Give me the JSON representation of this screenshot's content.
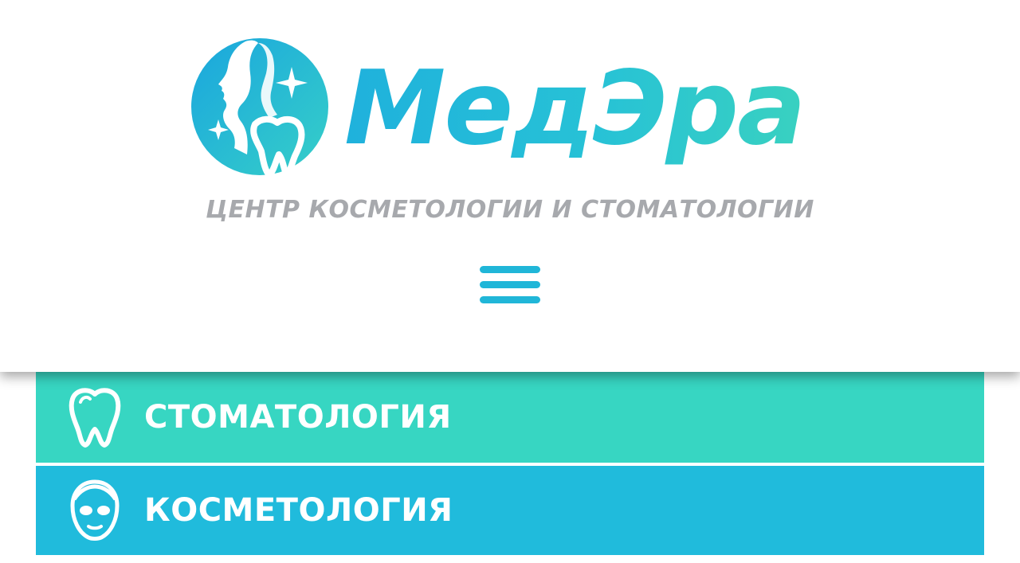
{
  "header": {
    "brand_name": "МедЭра",
    "tagline": "ЦЕНТР КОСМЕТОЛОГИИ И СТОМАТОЛОГИИ",
    "menu_icon": "hamburger-menu-icon"
  },
  "nav": {
    "items": [
      {
        "label": "СТОМАТОЛОГИЯ",
        "icon": "tooth-icon",
        "color": "#37d6c2"
      },
      {
        "label": "КОСМЕТОЛОГИЯ",
        "icon": "face-mask-icon",
        "color": "#20bbdc"
      }
    ]
  },
  "colors": {
    "brand_blue": "#1fb1dc",
    "brand_teal": "#39d1c0",
    "tagline_gray": "#a7a9ad"
  }
}
